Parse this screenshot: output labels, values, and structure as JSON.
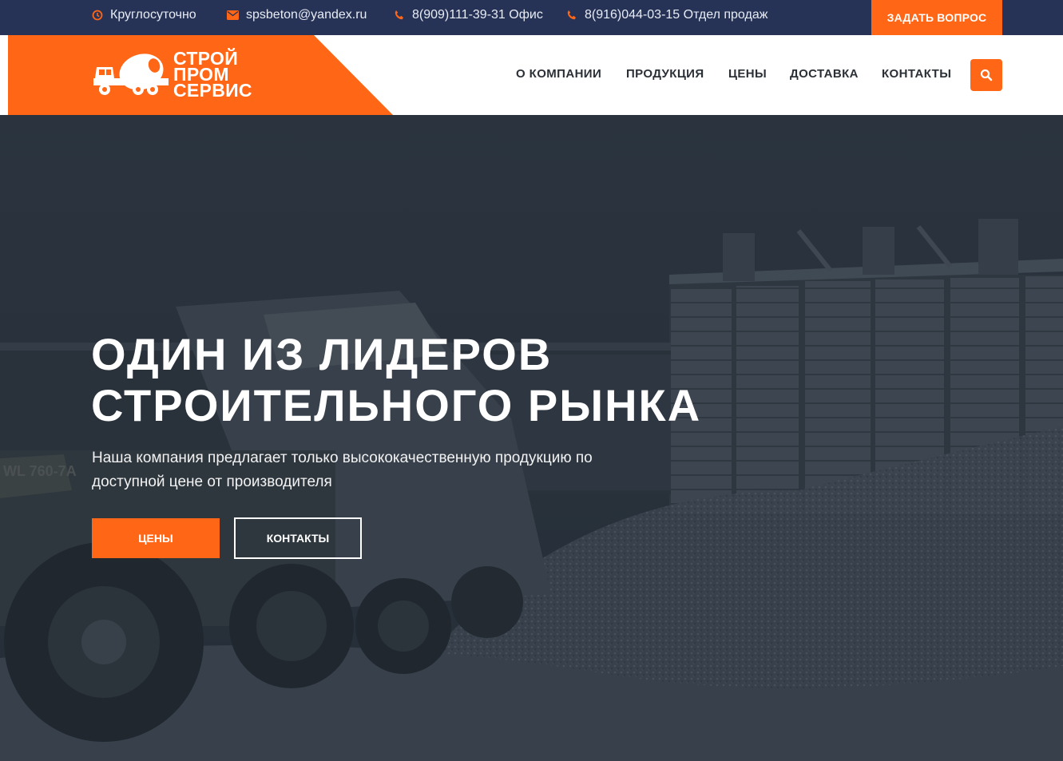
{
  "topbar": {
    "hours": "Круглосуточно",
    "email": "spsbeton@yandex.ru",
    "phone_office": "8(909)111-39-31 Офис",
    "phone_sales": "8(916)044-03-15 Отдел продаж",
    "ask_button": "ЗАДАТЬ ВОПРОС",
    "icons": [
      "clock-icon",
      "envelope-icon",
      "phone-icon",
      "phone-icon"
    ]
  },
  "logo": {
    "line1": "СТРОЙ",
    "line2": "ПРОМ",
    "line3": "СЕРВИС",
    "icon": "concrete-mixer-truck-icon"
  },
  "nav": {
    "items": [
      "О КОМПАНИИ",
      "ПРОДУКЦИЯ",
      "ЦЕНЫ",
      "ДОСТАВКА",
      "КОНТАКТЫ"
    ],
    "search_icon": "search-icon"
  },
  "hero": {
    "title_line1": "ОДИН ИЗ ЛИДЕРОВ",
    "title_line2": "СТРОИТЕЛЬНОГО РЫНКА",
    "subtitle_line1": "Наша компания предлагает только высококачественную продукцию по",
    "subtitle_line2": "доступной цене от производителя",
    "primary_button": "ЦЕНЫ",
    "secondary_button": "КОНТАКТЫ",
    "loader_marking": "WL 760-7A"
  },
  "colors": {
    "accent": "#ff6616",
    "topbar": "#263357",
    "hero_overlay": "#2c3540"
  }
}
